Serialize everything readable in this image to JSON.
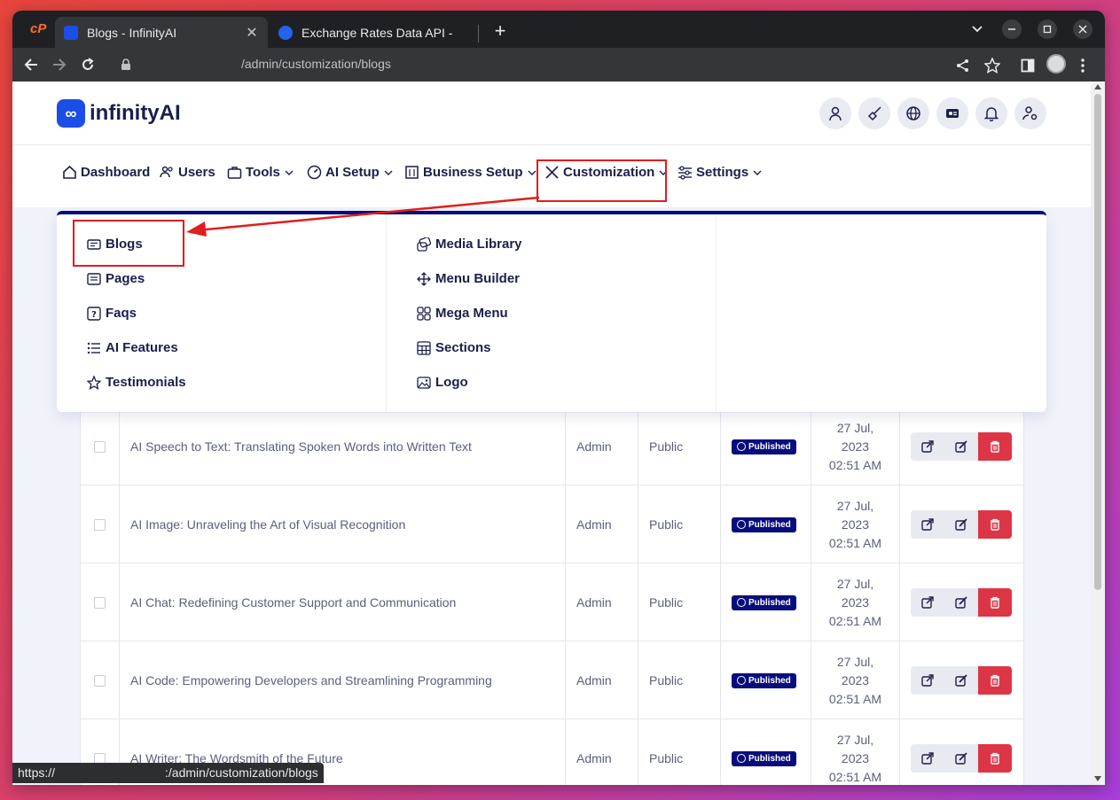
{
  "browser": {
    "tabs": [
      {
        "title": "Blogs - InfinityAI",
        "active": true
      },
      {
        "title": "Exchange Rates Data API - ",
        "active": false
      }
    ],
    "close_glyph": "✕",
    "new_tab_glyph": "+",
    "url": "/admin/customization/blogs",
    "status_prefix": "https://",
    "status_path": ":/admin/customization/blogs"
  },
  "app": {
    "logo_mark": "∞",
    "logo_text": "infinityAI"
  },
  "nav": {
    "items": [
      {
        "label": "Dashboard",
        "icon": "home-icon",
        "dropdown": false
      },
      {
        "label": "Users",
        "icon": "users-icon",
        "dropdown": false
      },
      {
        "label": "Tools",
        "icon": "briefcase-icon",
        "dropdown": true
      },
      {
        "label": "AI Setup",
        "icon": "gauge-icon",
        "dropdown": true
      },
      {
        "label": "Business Setup",
        "icon": "building-icon",
        "dropdown": true
      },
      {
        "label": "Customization",
        "icon": "tools-icon",
        "dropdown": true
      },
      {
        "label": "Settings",
        "icon": "sliders-icon",
        "dropdown": true
      }
    ]
  },
  "customization_menu": {
    "col1": [
      "Blogs",
      "Pages",
      "Faqs",
      "AI Features",
      "Testimonials"
    ],
    "col2": [
      "Media Library",
      "Menu Builder",
      "Mega Menu",
      "Sections",
      "Logo"
    ]
  },
  "blogs": {
    "rows": [
      {
        "title": "AI Speech to Text: Translating Spoken Words into Written Text",
        "author": "Admin",
        "visibility": "Public",
        "status": "Published",
        "date_day": "27 Jul,",
        "date_year": "2023",
        "date_time": "02:51 AM"
      },
      {
        "title": "AI Image: Unraveling the Art of Visual Recognition",
        "author": "Admin",
        "visibility": "Public",
        "status": "Published",
        "date_day": "27 Jul,",
        "date_year": "2023",
        "date_time": "02:51 AM"
      },
      {
        "title": "AI Chat: Redefining Customer Support and Communication",
        "author": "Admin",
        "visibility": "Public",
        "status": "Published",
        "date_day": "27 Jul,",
        "date_year": "2023",
        "date_time": "02:51 AM"
      },
      {
        "title": "AI Code: Empowering Developers and Streamlining Programming",
        "author": "Admin",
        "visibility": "Public",
        "status": "Published",
        "date_day": "27 Jul,",
        "date_year": "2023",
        "date_time": "02:51 AM"
      },
      {
        "title": "AI Writer: The Wordsmith of the Future",
        "author": "Admin",
        "visibility": "Public",
        "status": "Published",
        "date_day": "27 Jul,",
        "date_year": "2023",
        "date_time": "02:51 AM"
      }
    ]
  },
  "colors": {
    "brand": "#1a4ee6",
    "navy": "#080d7d",
    "danger": "#dc3545",
    "highlight": "#e11d1d"
  }
}
